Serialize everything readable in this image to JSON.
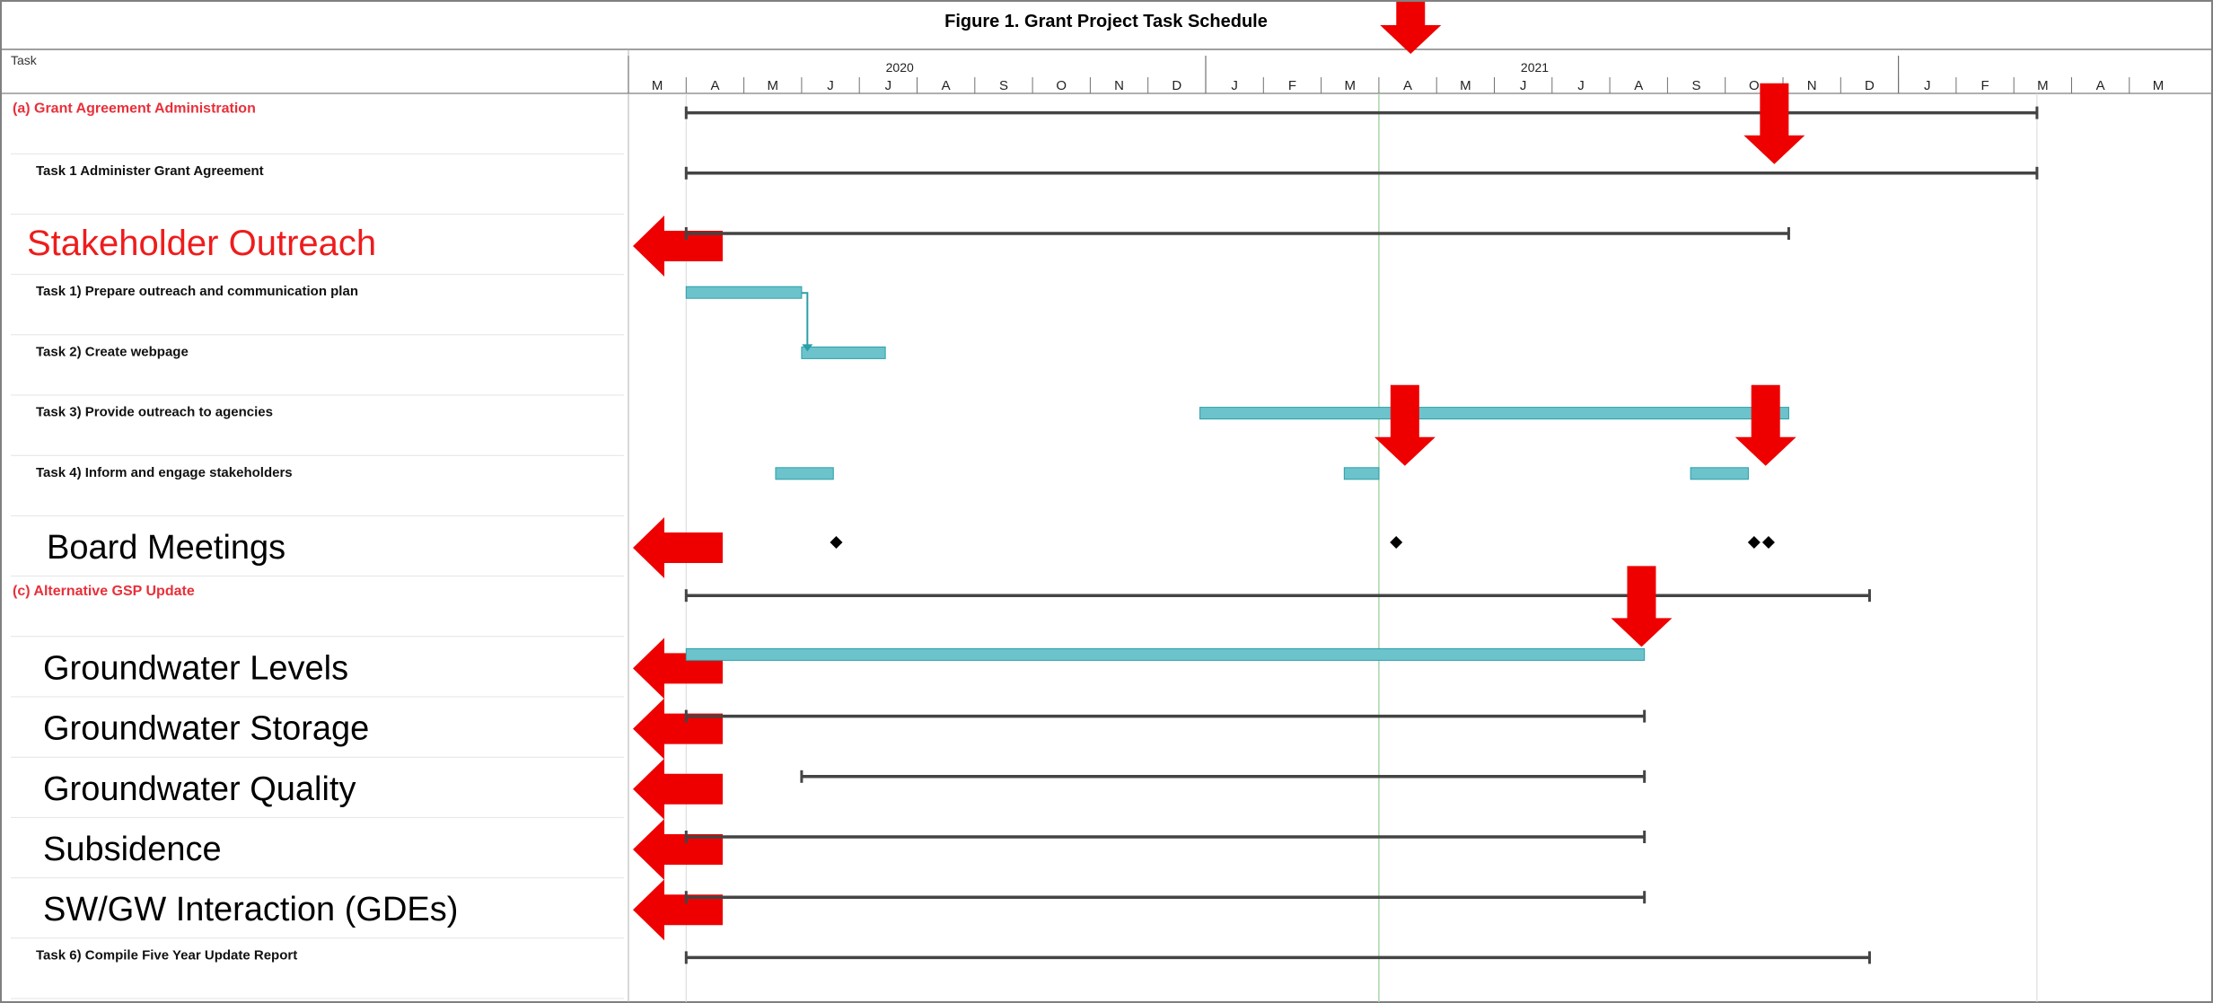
{
  "chart_data": {
    "type": "gantt",
    "title": "Figure 1.  Grant Project Task Schedule",
    "task_column_header": "Task",
    "timeline": {
      "start": "2020-03",
      "years": [
        {
          "label": "2020",
          "month_index": 0
        },
        {
          "label": "2021",
          "month_index": 10
        }
      ],
      "months": [
        "M",
        "A",
        "M",
        "J",
        "J",
        "A",
        "S",
        "O",
        "N",
        "D",
        "J",
        "F",
        "M",
        "A",
        "M",
        "J",
        "J",
        "A",
        "S",
        "O",
        "N",
        "D",
        "J",
        "F",
        "M",
        "A",
        "M"
      ],
      "today_line_month": 13
    },
    "rows": [
      {
        "label": "(a) Grant Agreement Administration",
        "style": "section",
        "bars": [
          {
            "kind": "summary",
            "start": 1.0,
            "end": 24.4
          }
        ]
      },
      {
        "label": "Task 1  Administer Grant Agreement",
        "style": "task",
        "bars": [
          {
            "kind": "summary",
            "start": 1.0,
            "end": 24.4
          }
        ]
      },
      {
        "label": "Stakeholder Outreach",
        "style": "callout-red",
        "arrow": true,
        "bars": [
          {
            "kind": "summary",
            "start": 1.0,
            "end": 20.1
          }
        ]
      },
      {
        "label": "Task 1)  Prepare outreach and communication plan",
        "style": "task",
        "bars": [
          {
            "kind": "task",
            "start": 1.0,
            "end": 3.0
          }
        ]
      },
      {
        "label": "Task 2)  Create webpage",
        "style": "task",
        "bars": [
          {
            "kind": "task",
            "start": 3.0,
            "end": 4.45
          }
        ]
      },
      {
        "label": "Task 3)  Provide outreach to agencies",
        "style": "task",
        "bars": [
          {
            "kind": "task",
            "start": 9.9,
            "end": 20.1
          }
        ]
      },
      {
        "label": "Task 4)  Inform and engage stakeholders",
        "style": "task",
        "bars": [
          {
            "kind": "task",
            "start": 2.55,
            "end": 3.55
          },
          {
            "kind": "task",
            "start": 12.4,
            "end": 13.0
          },
          {
            "kind": "task",
            "start": 18.4,
            "end": 19.4
          }
        ]
      },
      {
        "label": "Board Meetings",
        "style": "callout-black",
        "arrow": true,
        "milestones": [
          3.6,
          13.3,
          19.5,
          19.75
        ]
      },
      {
        "label": "(c) Alternative GSP Update",
        "style": "section",
        "bars": [
          {
            "kind": "summary",
            "start": 1.0,
            "end": 21.5
          }
        ]
      },
      {
        "label": "Groundwater Levels",
        "style": "callout-black",
        "arrow": true,
        "bars": [
          {
            "kind": "task",
            "start": 1.0,
            "end": 17.6
          }
        ]
      },
      {
        "label": "Groundwater Storage",
        "style": "callout-black",
        "arrow": true,
        "bars": [
          {
            "kind": "summary",
            "start": 1.0,
            "end": 17.6
          }
        ]
      },
      {
        "label": "Groundwater Quality",
        "style": "callout-black",
        "arrow": true,
        "bars": [
          {
            "kind": "summary",
            "start": 3.0,
            "end": 17.6
          }
        ]
      },
      {
        "label": "Subsidence",
        "style": "callout-black",
        "arrow": true,
        "bars": [
          {
            "kind": "summary",
            "start": 1.0,
            "end": 17.6
          }
        ]
      },
      {
        "label": "SW/GW Interaction (GDEs)",
        "style": "callout-black",
        "arrow": true,
        "bars": [
          {
            "kind": "summary",
            "start": 1.0,
            "end": 17.6
          }
        ]
      },
      {
        "label": "Task 6) Compile Five Year Update Report",
        "style": "task",
        "bars": [
          {
            "kind": "summary",
            "start": 1.0,
            "end": 21.5
          }
        ]
      }
    ],
    "down_arrows": [
      {
        "month": 13.55,
        "row": -1
      },
      {
        "month": 19.85,
        "row": 1
      },
      {
        "month": 13.45,
        "row": 6
      },
      {
        "month": 19.7,
        "row": 6
      },
      {
        "month": 17.55,
        "row": 9
      }
    ],
    "colors": {
      "section_text": "#e8303a",
      "callout_red": "#ee1c1c",
      "task_bar": "#6cc3cb",
      "task_bar_edge": "#2b9ea8",
      "summary_bar": "#444444",
      "arrow": "#ee0000",
      "grid": "#d8d8d8",
      "today_line": "#a8d6a8"
    }
  }
}
